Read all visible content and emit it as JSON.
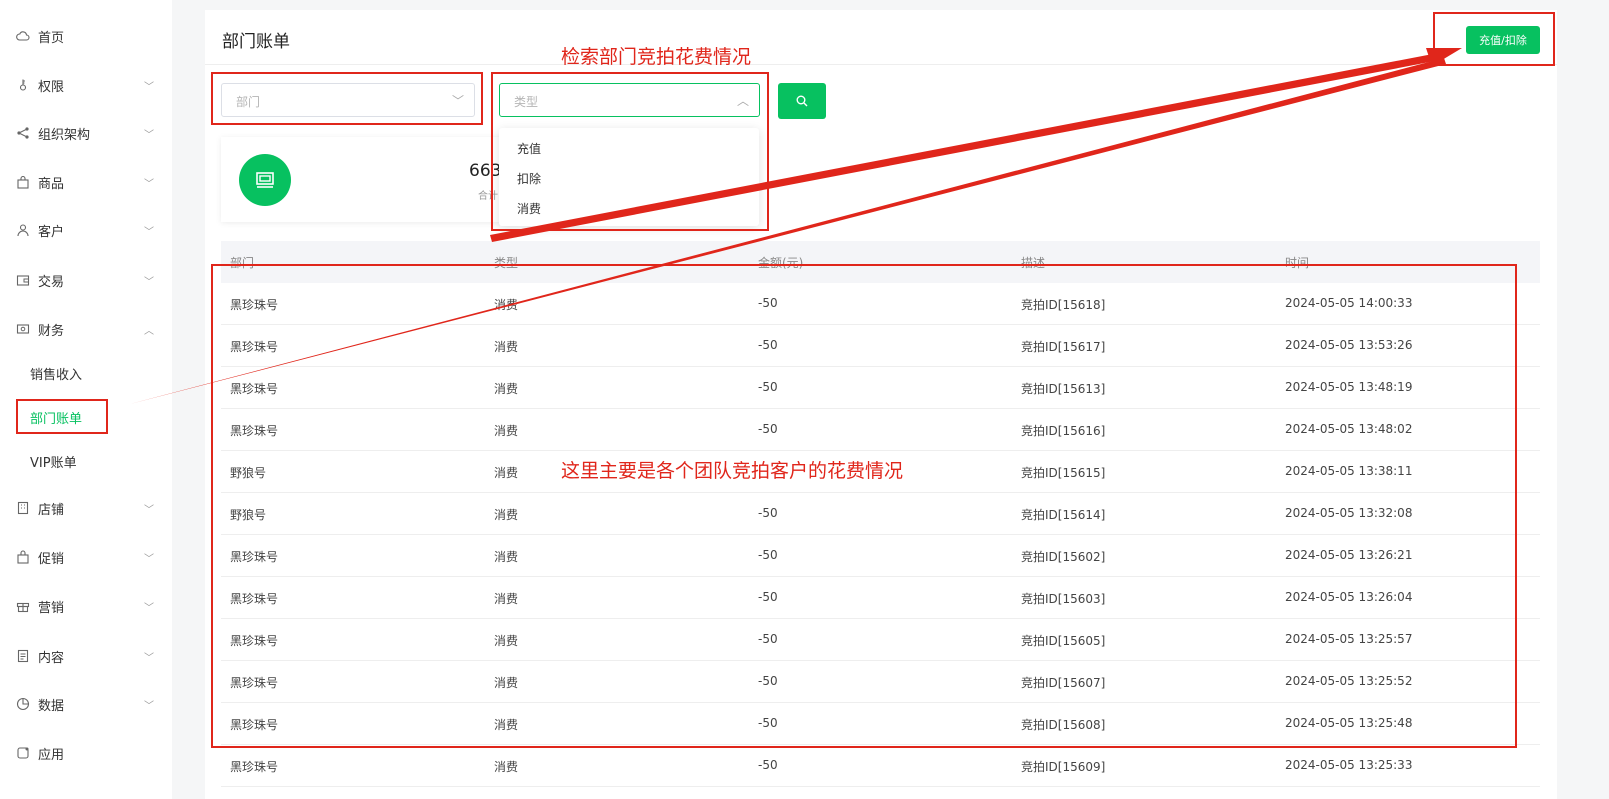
{
  "sidebar": {
    "items": [
      {
        "label": "首页",
        "icon": "cloud-icon"
      },
      {
        "label": "权限",
        "icon": "key-icon"
      },
      {
        "label": "组织架构",
        "icon": "share-icon"
      },
      {
        "label": "商品",
        "icon": "bag-icon"
      },
      {
        "label": "客户",
        "icon": "user-icon"
      },
      {
        "label": "交易",
        "icon": "wallet-icon"
      },
      {
        "label": "财务",
        "icon": "money-icon"
      },
      {
        "label": "店铺",
        "icon": "building-icon"
      },
      {
        "label": "促销",
        "icon": "gift-bag-icon"
      },
      {
        "label": "营销",
        "icon": "gift-icon"
      },
      {
        "label": "内容",
        "icon": "document-icon"
      },
      {
        "label": "数据",
        "icon": "pie-chart-icon"
      },
      {
        "label": "应用",
        "icon": "app-icon"
      }
    ],
    "finance_sub": [
      "销售收入",
      "部门账单",
      "VIP账单"
    ]
  },
  "page": {
    "title": "部门账单",
    "action_button": "充值/扣除"
  },
  "filters": {
    "department_placeholder": "部门",
    "type_placeholder": "类型",
    "type_options": [
      "充值",
      "扣除",
      "消费"
    ]
  },
  "stat": {
    "value": "663",
    "label": "合计"
  },
  "table": {
    "headers": [
      "部门",
      "类型",
      "金额(元)",
      "描述",
      "时间"
    ],
    "rows": [
      [
        "黑珍珠号",
        "消费",
        "-50",
        "竞拍ID[15618]",
        "2024-05-05 14:00:33"
      ],
      [
        "黑珍珠号",
        "消费",
        "-50",
        "竞拍ID[15617]",
        "2024-05-05 13:53:26"
      ],
      [
        "黑珍珠号",
        "消费",
        "-50",
        "竞拍ID[15613]",
        "2024-05-05 13:48:19"
      ],
      [
        "黑珍珠号",
        "消费",
        "-50",
        "竞拍ID[15616]",
        "2024-05-05 13:48:02"
      ],
      [
        "野狼号",
        "消费",
        "",
        "竞拍ID[15615]",
        "2024-05-05 13:38:11"
      ],
      [
        "野狼号",
        "消费",
        "-50",
        "竞拍ID[15614]",
        "2024-05-05 13:32:08"
      ],
      [
        "黑珍珠号",
        "消费",
        "-50",
        "竞拍ID[15602]",
        "2024-05-05 13:26:21"
      ],
      [
        "黑珍珠号",
        "消费",
        "-50",
        "竞拍ID[15603]",
        "2024-05-05 13:26:04"
      ],
      [
        "黑珍珠号",
        "消费",
        "-50",
        "竞拍ID[15605]",
        "2024-05-05 13:25:57"
      ],
      [
        "黑珍珠号",
        "消费",
        "-50",
        "竞拍ID[15607]",
        "2024-05-05 13:25:52"
      ],
      [
        "黑珍珠号",
        "消费",
        "-50",
        "竞拍ID[15608]",
        "2024-05-05 13:25:48"
      ],
      [
        "黑珍珠号",
        "消费",
        "-50",
        "竞拍ID[15609]",
        "2024-05-05 13:25:33"
      ]
    ]
  },
  "annotations": {
    "search_note": "检索部门竞拍花费情况",
    "table_note": "这里主要是各个团队竞拍客户的花费情况"
  },
  "colors": {
    "accent": "#07c160",
    "annotation": "#e0261b"
  }
}
